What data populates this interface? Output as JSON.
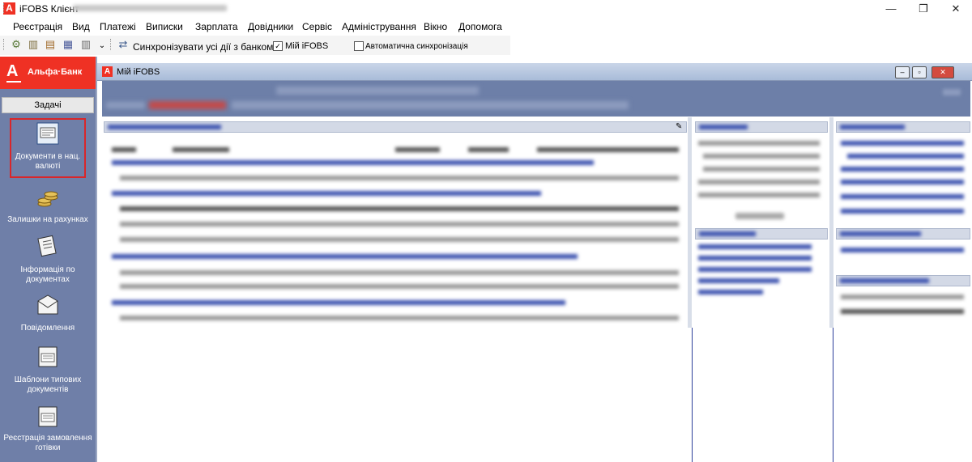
{
  "titlebar": {
    "app_title": "iFOBS Клієнт",
    "minimize": "—",
    "maximize": "❐",
    "close": "✕"
  },
  "menu": {
    "items": [
      "Реєстрація",
      "Вид",
      "Платежі",
      "Виписки",
      "Зарплата",
      "Довідники",
      "Сервіс",
      "Адміністрування",
      "Вікно",
      "Допомога"
    ]
  },
  "toolbar": {
    "sync_label": "Синхронізувати усі дії з банком",
    "my_ifobs_label": "Мій iFOBS",
    "my_ifobs_checked": true,
    "autosync_label": "Автоматична синхронізація",
    "autosync_checked": false
  },
  "sidebar": {
    "bank_logo": "А",
    "bank_name": "Альфа·Банк",
    "tasks_header": "Задачі",
    "items": [
      {
        "label": "Документи в нац. валюті",
        "icon": "document-icon",
        "selected": true
      },
      {
        "label": "Залишки на рахунках",
        "icon": "coins-icon"
      },
      {
        "label": "Інформація по документах",
        "icon": "document-info-icon"
      },
      {
        "label": "Повідомлення",
        "icon": "envelope-icon"
      },
      {
        "label": "Шаблони типових документів",
        "icon": "template-icon"
      },
      {
        "label": "Реєстрація замовлення готівки",
        "icon": "cash-order-icon"
      }
    ],
    "highlight_color": "#d9262a"
  },
  "window": {
    "logo": "А",
    "title": "Мій iFOBS"
  },
  "colors": {
    "brand_red": "#ef3124",
    "sidebar_bg": "#6f7fa8",
    "header_bg": "#6d7fa8"
  }
}
